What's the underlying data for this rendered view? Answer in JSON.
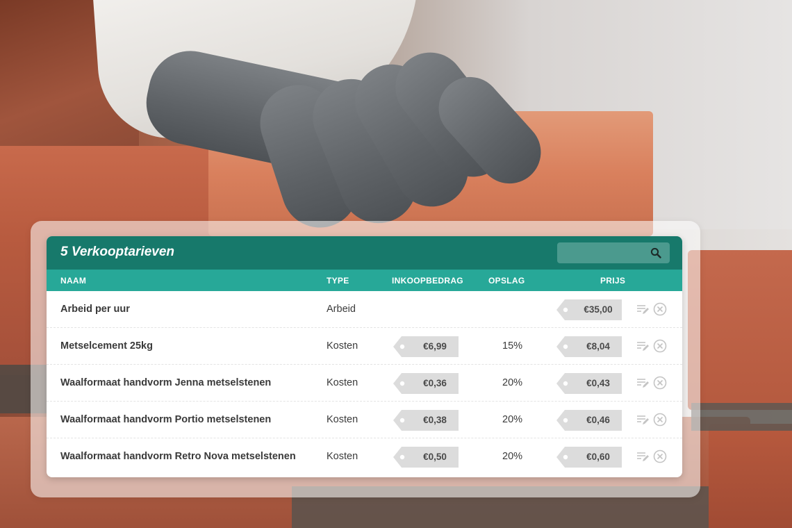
{
  "table": {
    "title": "5 Verkooptarieven",
    "search": {
      "placeholder": "",
      "value": ""
    },
    "columns": {
      "naam": "NAAM",
      "type": "TYPE",
      "inkoopbedrag": "INKOOPBEDRAG",
      "opslag": "OPSLAG",
      "prijs": "PRIJS"
    },
    "rows": [
      {
        "naam": "Arbeid per uur",
        "type": "Arbeid",
        "inkoop": "",
        "opslag": "",
        "prijs": "€35,00"
      },
      {
        "naam": "Metselcement 25kg",
        "type": "Kosten",
        "inkoop": "€6,99",
        "opslag": "15%",
        "prijs": "€8,04"
      },
      {
        "naam": "Waalformaat handvorm Jenna metselstenen",
        "type": "Kosten",
        "inkoop": "€0,36",
        "opslag": "20%",
        "prijs": "€0,43"
      },
      {
        "naam": "Waalformaat handvorm Portio metselstenen",
        "type": "Kosten",
        "inkoop": "€0,38",
        "opslag": "20%",
        "prijs": "€0,46"
      },
      {
        "naam": "Waalformaat handvorm Retro Nova metselstenen",
        "type": "Kosten",
        "inkoop": "€0,50",
        "opslag": "20%",
        "prijs": "€0,60"
      }
    ]
  },
  "icons": {
    "search": "search-icon",
    "price_tag": "price-tag-icon",
    "edit": "edit-icon",
    "remove": "remove-icon"
  },
  "colors": {
    "header": "#17796b",
    "column_header": "#27a898",
    "tag": "#dcdcdc"
  }
}
